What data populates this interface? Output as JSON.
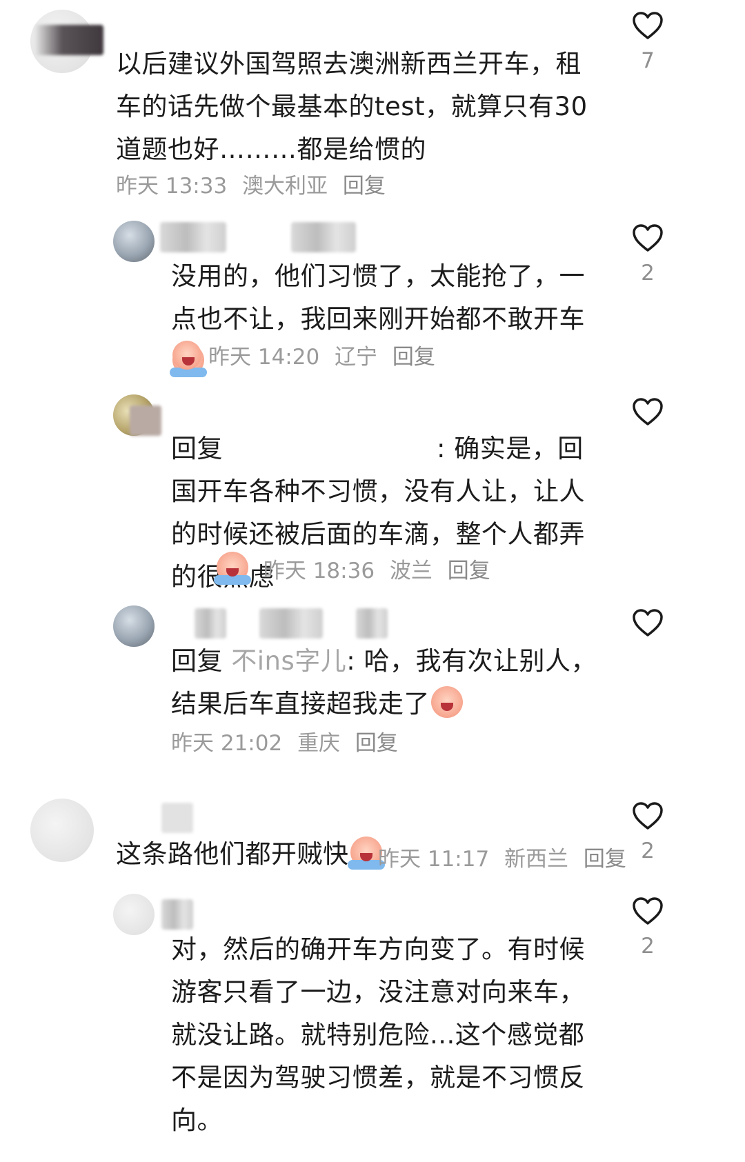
{
  "comments": [
    {
      "text": "以后建议外国驾照去澳洲新西兰开车，租车的话先做个最基本的test，就算只有30道题也好………都是给惯的",
      "time": "昨天 13:33",
      "location": "澳大利亚",
      "reply": "回复",
      "likes": "7"
    },
    {
      "text": "没用的，他们习惯了，太能抢了，一点也不让，我回来刚开始都不敢开车",
      "time": "昨天 14:20",
      "location": "辽宁",
      "reply": "回复",
      "likes": "2"
    },
    {
      "prefix": "回复",
      "text": ": 确实是，回国开车各种不习惯，没有人让，让人的时候还被后面的车滴，整个人都弄的很焦虑",
      "time": "昨天 18:36",
      "location": "波兰",
      "reply": "回复",
      "likes": ""
    },
    {
      "prefix": "回复",
      "target": "不ins字儿",
      "text": ": 哈，我有次让别人，结果后车直接超我走了",
      "time": "昨天 21:02",
      "location": "重庆",
      "reply": "回复",
      "likes": ""
    },
    {
      "text": "这条路他们都开贼快",
      "time": "昨天 11:17",
      "location": "新西兰",
      "reply": "回复",
      "likes": "2"
    },
    {
      "text": "对，然后的确开车方向变了。有时候游客只看了一边，没注意对向来车，就没让路。就特别危险...这个感觉都不是因为驾驶习惯差，就是不习惯反向。",
      "likes": "2"
    }
  ],
  "icons": {
    "like": "heart-outline-icon",
    "emoji": "crying-face-emoji-icon"
  },
  "colors": {
    "text": "#1c1c1c",
    "meta": "#9a9a9a",
    "heart": "#1a1a1a"
  }
}
